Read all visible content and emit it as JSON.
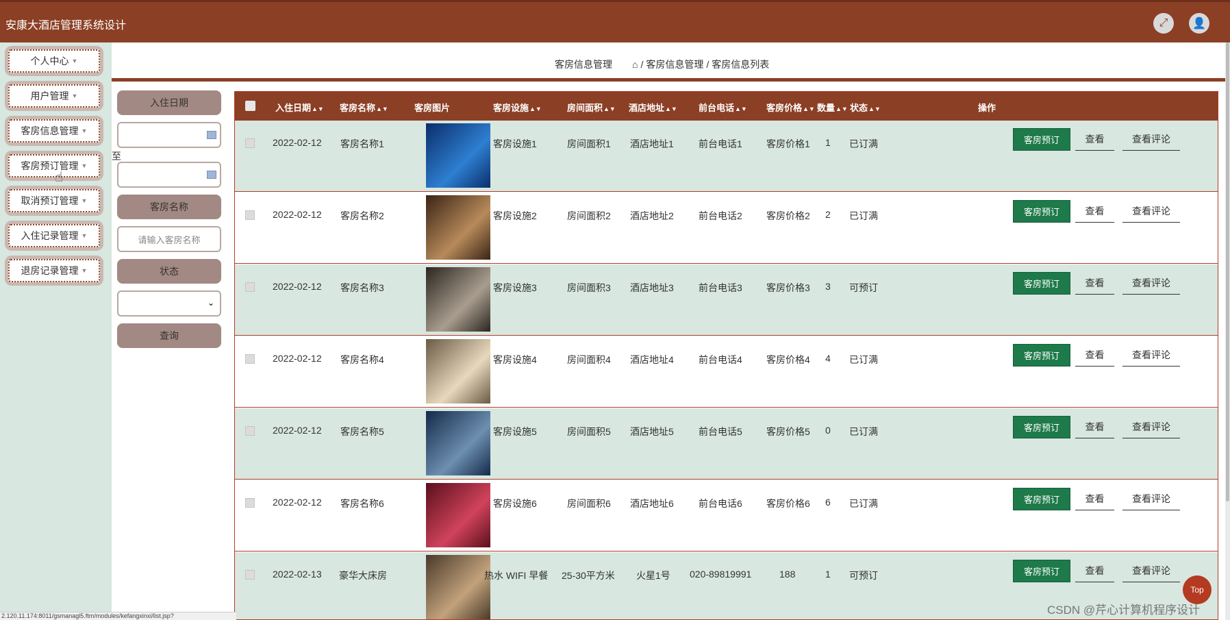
{
  "app": {
    "title": "安康大酒店管理系统设计"
  },
  "sidebar": {
    "items": [
      {
        "label": "个人中心"
      },
      {
        "label": "用户管理"
      },
      {
        "label": "客房信息管理"
      },
      {
        "label": "客房预订管理"
      },
      {
        "label": "取消预订管理"
      },
      {
        "label": "入住记录管理"
      },
      {
        "label": "退房记录管理"
      }
    ]
  },
  "breadcrumb": {
    "title": "客房信息管理",
    "path": [
      "客房信息管理",
      "客房信息列表"
    ],
    "separator": "/"
  },
  "filter": {
    "checkin_label": "入住日期",
    "to_label": "至",
    "room_name_label": "客房名称",
    "room_name_placeholder": "请输入客房名称",
    "status_label": "状态",
    "query_label": "查询"
  },
  "table": {
    "headers": {
      "date": "入住日期",
      "name": "客房名称",
      "image": "客房图片",
      "facility": "客房设施",
      "area": "房间面积",
      "address": "酒店地址",
      "phone": "前台电话",
      "price": "客房价格",
      "count": "数量",
      "status": "状态",
      "actions": "操作"
    },
    "actions": {
      "book": "客房预订",
      "view": "查看",
      "comment": "查看评论"
    },
    "rows": [
      {
        "date": "2022-02-12",
        "name": "客房名称1",
        "facility": "客房设施1",
        "area": "房间面积1",
        "address": "酒店地址1",
        "phone": "前台电话1",
        "price": "客房价格1",
        "count": "1",
        "status": "已订满",
        "img_a": "#0b2d6b",
        "img_b": "#2e7fd1"
      },
      {
        "date": "2022-02-12",
        "name": "客房名称2",
        "facility": "客房设施2",
        "area": "房间面积2",
        "address": "酒店地址2",
        "phone": "前台电话2",
        "price": "客房价格2",
        "count": "2",
        "status": "已订满",
        "img_a": "#3a2416",
        "img_b": "#b78a5a"
      },
      {
        "date": "2022-02-12",
        "name": "客房名称3",
        "facility": "客房设施3",
        "area": "房间面积3",
        "address": "酒店地址3",
        "phone": "前台电话3",
        "price": "客房价格3",
        "count": "3",
        "status": "可预订",
        "img_a": "#2b2620",
        "img_b": "#a99d8e"
      },
      {
        "date": "2022-02-12",
        "name": "客房名称4",
        "facility": "客房设施4",
        "area": "房间面积4",
        "address": "酒店地址4",
        "phone": "前台电话4",
        "price": "客房价格4",
        "count": "4",
        "status": "已订满",
        "img_a": "#6b5a45",
        "img_b": "#e7d8bd"
      },
      {
        "date": "2022-02-12",
        "name": "客房名称5",
        "facility": "客房设施5",
        "area": "房间面积5",
        "address": "酒店地址5",
        "phone": "前台电话5",
        "price": "客房价格5",
        "count": "0",
        "status": "已订满",
        "img_a": "#142a4a",
        "img_b": "#6d8fb0"
      },
      {
        "date": "2022-02-12",
        "name": "客房名称6",
        "facility": "客房设施6",
        "area": "房间面积6",
        "address": "酒店地址6",
        "phone": "前台电话6",
        "price": "客房价格6",
        "count": "6",
        "status": "已订满",
        "img_a": "#5a0f1c",
        "img_b": "#d0435b"
      },
      {
        "date": "2022-02-13",
        "name": "豪华大床房",
        "facility": "热水 WIFI 早餐",
        "area": "25-30平方米",
        "address": "火星1号",
        "phone": "020-89819991",
        "price": "188",
        "count": "1",
        "status": "可预订",
        "img_a": "#4a3a2a",
        "img_b": "#c2a27c"
      }
    ]
  },
  "floating": {
    "top_label": "Top"
  },
  "watermark": "CSDN @芹心计算机程序设计",
  "statusbar": "2.120.11.174:8011/gsmanagl5.ftm/modules/kefangxinxi/list.jsp?"
}
